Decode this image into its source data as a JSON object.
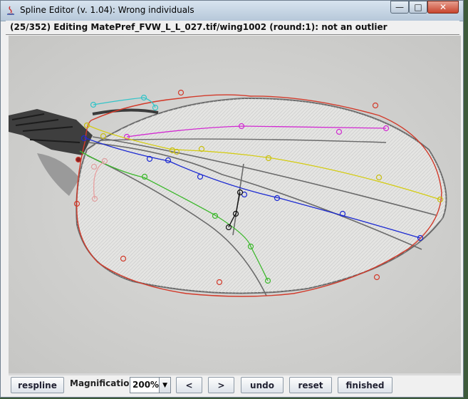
{
  "window": {
    "title": "Spline Editor (v. 1.04): Wrong individuals",
    "controls": {
      "minimize": "—",
      "maximize": "□",
      "close": "✕"
    }
  },
  "status_text": "(25/352) Editing MatePref_FVW_L_L_027.tif/wing1002 (round:1): not an outlier",
  "toolbar": {
    "respline": "respline",
    "magnification_label": "Magnification:",
    "magnification_value": "200%",
    "prev": "<",
    "next": ">",
    "undo": "undo",
    "reset": "reset",
    "finished": "finished"
  },
  "colors": {
    "outline": "#d23a2a",
    "vein_cyan": "#33c4c8",
    "vein_magenta": "#d22ad2",
    "vein_yellow": "#d4cc10",
    "vein_blue": "#1c2ad2",
    "vein_green": "#3cb82c",
    "vein_pink": "#e8a0a0",
    "crossvein": "#111111"
  }
}
